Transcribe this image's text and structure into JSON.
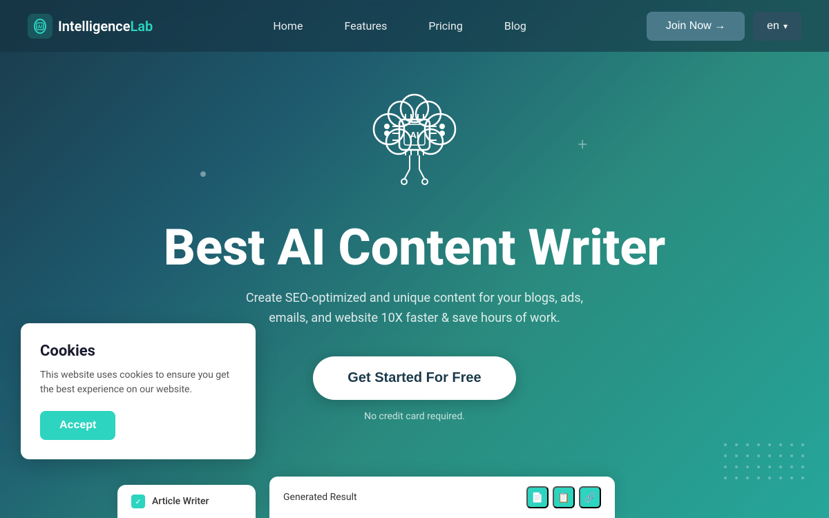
{
  "nav": {
    "logo_text_1": "Intelligence",
    "logo_text_2": "Lab",
    "links": [
      {
        "label": "Home",
        "id": "home"
      },
      {
        "label": "Features",
        "id": "features"
      },
      {
        "label": "Pricing",
        "id": "pricing"
      },
      {
        "label": "Blog",
        "id": "blog"
      }
    ],
    "join_now_label": "Join Now →",
    "lang_label": "en",
    "lang_chevron": "▾"
  },
  "hero": {
    "title": "Best AI Content Writer",
    "subtitle_line1": "Create SEO-optimized and unique content for your blogs, ads,",
    "subtitle_line2": "emails, and website 10X faster & save hours of work.",
    "cta_label": "Get Started For Free",
    "no_card_text": "No credit card required."
  },
  "cookie": {
    "title": "Cookies",
    "text": "This website uses cookies to ensure you get the best experience on our website.",
    "accept_label": "Accept"
  },
  "preview": {
    "card1_label": "Article Writer",
    "card2_label": "Generated Result",
    "btn1": "📄",
    "btn2": "📋",
    "btn3": "🔗"
  },
  "decorations": {
    "plus_symbol": "+",
    "dot_symbol": "•"
  }
}
